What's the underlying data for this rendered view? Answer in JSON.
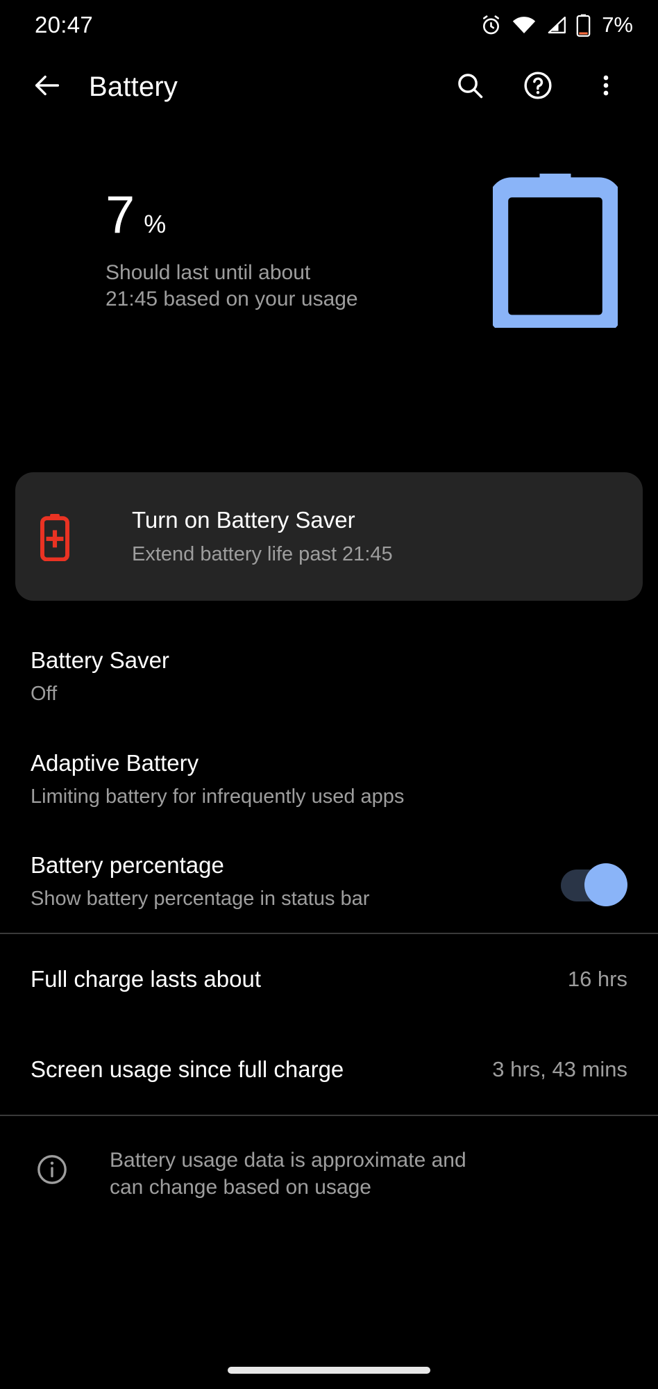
{
  "status_bar": {
    "time": "20:47",
    "battery_percent": "7%",
    "icons": [
      "alarm-icon",
      "wifi-icon",
      "cell-signal-icon",
      "battery-icon"
    ]
  },
  "toolbar": {
    "back_label": "back-arrow",
    "title": "Battery",
    "actions": [
      "search-icon",
      "help-icon",
      "overflow-menu-icon"
    ]
  },
  "hero": {
    "percent_number": "7",
    "percent_sign": "%",
    "estimate_line1": "Should last until about",
    "estimate_line2": "21:45 based on your usage",
    "battery_graphic_color": "#8ab4f8"
  },
  "suggestion_card": {
    "icon": "battery-saver-icon",
    "icon_color": "#ea3323",
    "title": "Turn on Battery Saver",
    "subtitle": "Extend battery life past 21:45",
    "background": "#252525"
  },
  "preferences": [
    {
      "title": "Battery Saver",
      "subtitle": "Off",
      "has_toggle": false
    },
    {
      "title": "Adaptive Battery",
      "subtitle": "Limiting battery for infrequently used apps",
      "has_toggle": false
    },
    {
      "title": "Battery percentage",
      "subtitle": "Show battery percentage in status bar",
      "has_toggle": true,
      "toggle_on": true,
      "toggle_track_color": "#2a3547",
      "toggle_thumb_color": "#8ab4f8"
    }
  ],
  "info_rows": [
    {
      "label": "Full charge lasts about",
      "value": "16 hrs"
    },
    {
      "label": "Screen usage since full charge",
      "value": "3 hrs, 43 mins"
    }
  ],
  "footer": {
    "icon": "info-icon",
    "line1": "Battery usage data is approximate and",
    "line2": "can change based on usage"
  }
}
